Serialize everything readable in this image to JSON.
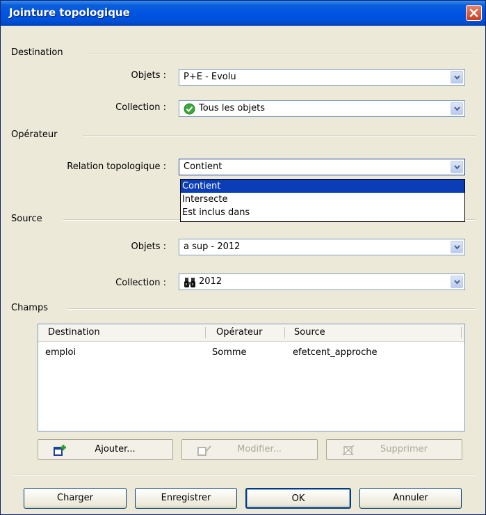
{
  "window": {
    "title": "Jointure topologique"
  },
  "destination": {
    "group_label": "Destination",
    "objets_label": "Objets :",
    "objets_value": "P+E - Evolu",
    "collection_label": "Collection :",
    "collection_value": "Tous les objets"
  },
  "operateur": {
    "group_label": "Opérateur",
    "relation_label": "Relation topologique :",
    "relation_value": "Contient",
    "dropdown_options": [
      "Contient",
      "Intersecte",
      "Est inclus dans"
    ],
    "selected_option": "Contient"
  },
  "source": {
    "group_label": "Source",
    "objets_label": "Objets :",
    "objets_value": "a sup - 2012",
    "collection_label": "Collection :",
    "collection_value": "2012"
  },
  "champs": {
    "group_label": "Champs",
    "columns": [
      "Destination",
      "Opérateur",
      "Source"
    ],
    "rows": [
      [
        "emploi",
        "Somme",
        "efetcent_approche"
      ]
    ],
    "add_label": "Ajouter...",
    "modify_label": "Modifier...",
    "delete_label": "Supprimer"
  },
  "footer": {
    "load_label": "Charger",
    "save_label": "Enregistrer",
    "ok_label": "OK",
    "cancel_label": "Annuler"
  },
  "colors": {
    "titlebar": "#0054e3",
    "dialog_bg": "#ece9d8",
    "selection": "#0a3db6"
  }
}
